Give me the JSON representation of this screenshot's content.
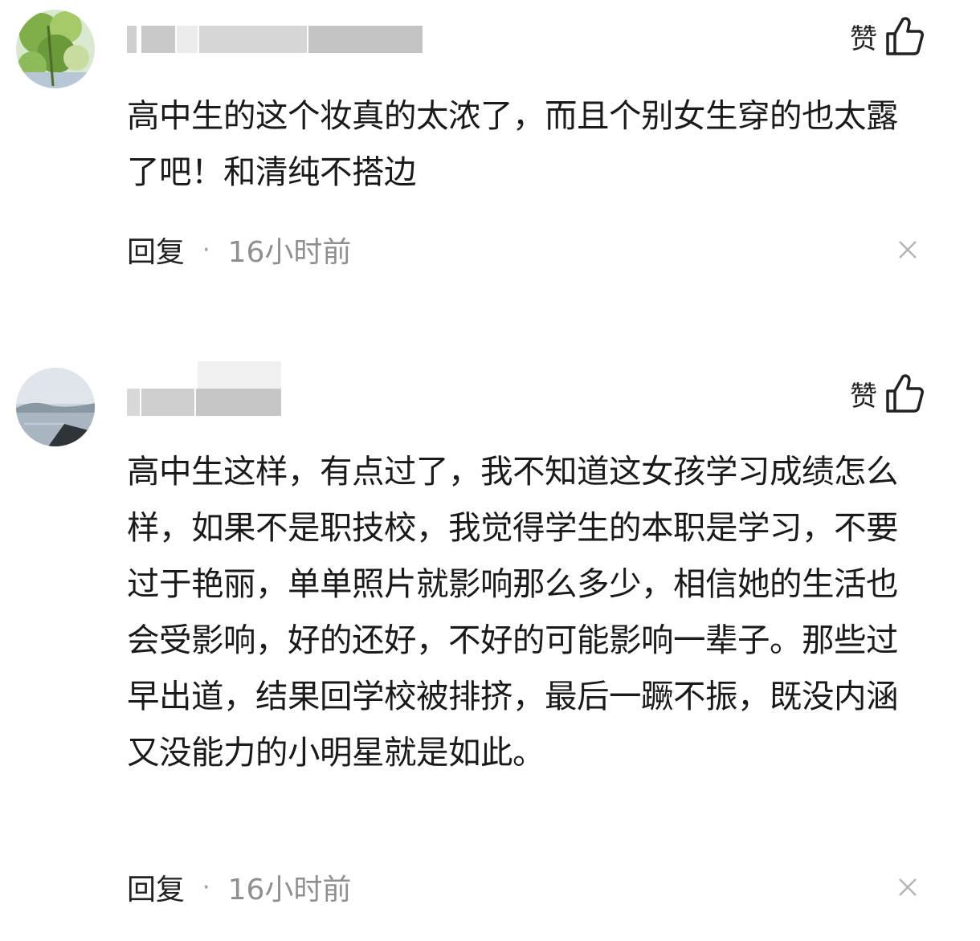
{
  "comments": [
    {
      "like_label": "赞",
      "text": "高中生的这个妆真的太浓了，而且个别女生穿的也太露了吧！和清纯不搭边",
      "reply_label": "回复",
      "separator": "·",
      "time": "16小时前"
    },
    {
      "like_label": "赞",
      "text": "高中生这样，有点过了，我不知道这女孩学习成绩怎么样，如果不是职技校，我觉得学生的本职是学习，不要过于艳丽，单单照片就影响那么多少，相信她的生活也会受影响，好的还好，不好的可能影响一辈子。那些过早出道，结果回学校被排挤，最后一蹶不振，既没内涵又没能力的小明星就是如此。",
      "reply_label": "回复",
      "separator": "·",
      "time": "16小时前"
    }
  ],
  "icons": {
    "like": "thumbs-up-icon",
    "close": "close-icon"
  },
  "colors": {
    "text": "#1a1a1a",
    "meta": "#8f8f8f",
    "background": "#ffffff"
  }
}
